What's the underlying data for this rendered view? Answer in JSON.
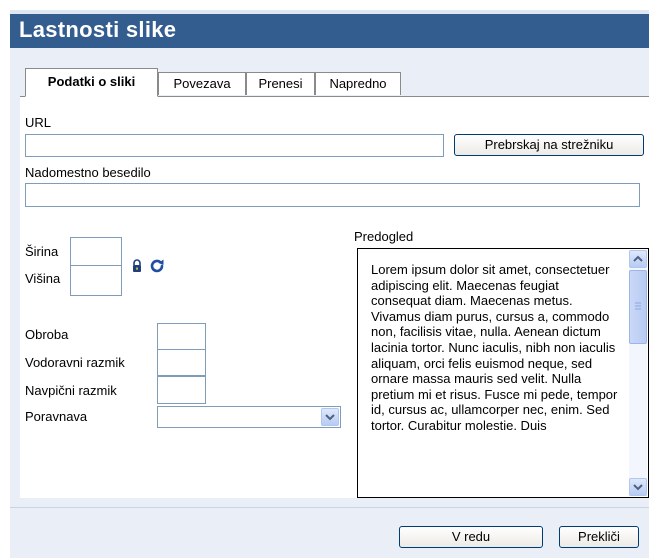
{
  "dialog": {
    "title": "Lastnosti slike"
  },
  "tabs": [
    {
      "label": "Podatki o sliki",
      "active": true
    },
    {
      "label": "Povezava",
      "active": false
    },
    {
      "label": "Prenesi",
      "active": false
    },
    {
      "label": "Napredno",
      "active": false
    }
  ],
  "form": {
    "url_label": "URL",
    "url_value": "",
    "browse_button": "Prebrskaj na strežniku",
    "alt_label": "Nadomestno besedilo",
    "alt_value": "",
    "width_label": "Širina",
    "width_value": "",
    "height_label": "Višina",
    "height_value": "",
    "border_label": "Obroba",
    "hspace_label": "Vodoravni razmik",
    "vspace_label": "Navpični razmik",
    "align_label": "Poravnava",
    "align_value": ""
  },
  "preview": {
    "label": "Predogled",
    "text": "Lorem ipsum dolor sit amet, consectetuer adipiscing elit. Maecenas feugiat consequat diam. Maecenas metus. Vivamus diam purus, cursus a, commodo non, facilisis vitae, nulla. Aenean dictum lacinia tortor. Nunc iaculis, nibh non iaculis aliquam, orci felis euismod neque, sed ornare massa mauris sed velit. Nulla pretium mi et risus. Fusce mi pede, tempor id, cursus ac, ullamcorper nec, enim. Sed tortor. Curabitur molestie. Duis"
  },
  "footer": {
    "ok_button": "V redu",
    "cancel_button": "Prekliči"
  },
  "icons": {
    "lock": "lock-icon",
    "reset": "reset-size-icon",
    "dropdown": "chevron-down-icon",
    "scroll_up": "scroll-up-icon",
    "scroll_down": "scroll-down-icon"
  },
  "colors": {
    "titlebar": "#335c8f",
    "dialog_bg": "#e9eef7",
    "input_border": "#7f9db9",
    "button_border": "#003c74"
  }
}
